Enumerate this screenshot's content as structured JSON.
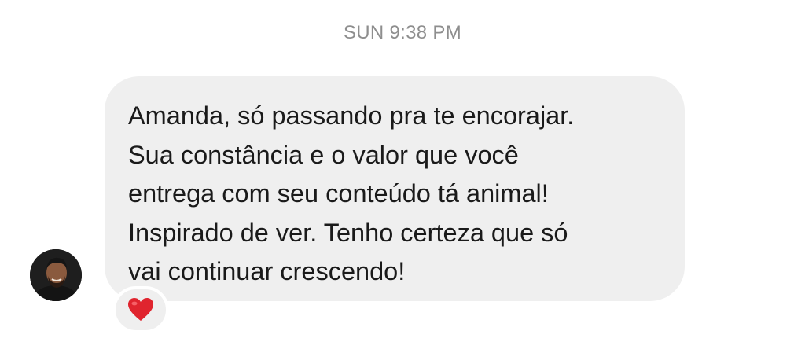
{
  "timestamp": "SUN 9:38 PM",
  "message": {
    "text": "Amanda, só passando pra te encorajar.\nSua constância e o valor que você\nentrega com seu conteúdo tá animal!\nInspirado de ver. Tenho certeza que só\nvai continuar crescendo!",
    "sender_avatar_icon": "avatar-photo",
    "reaction_icon": "red-heart-icon"
  },
  "colors": {
    "bubble_bg": "#efefef",
    "timestamp": "#8e8e8e",
    "text": "#1a1a1a",
    "heart": "#e0242e"
  }
}
